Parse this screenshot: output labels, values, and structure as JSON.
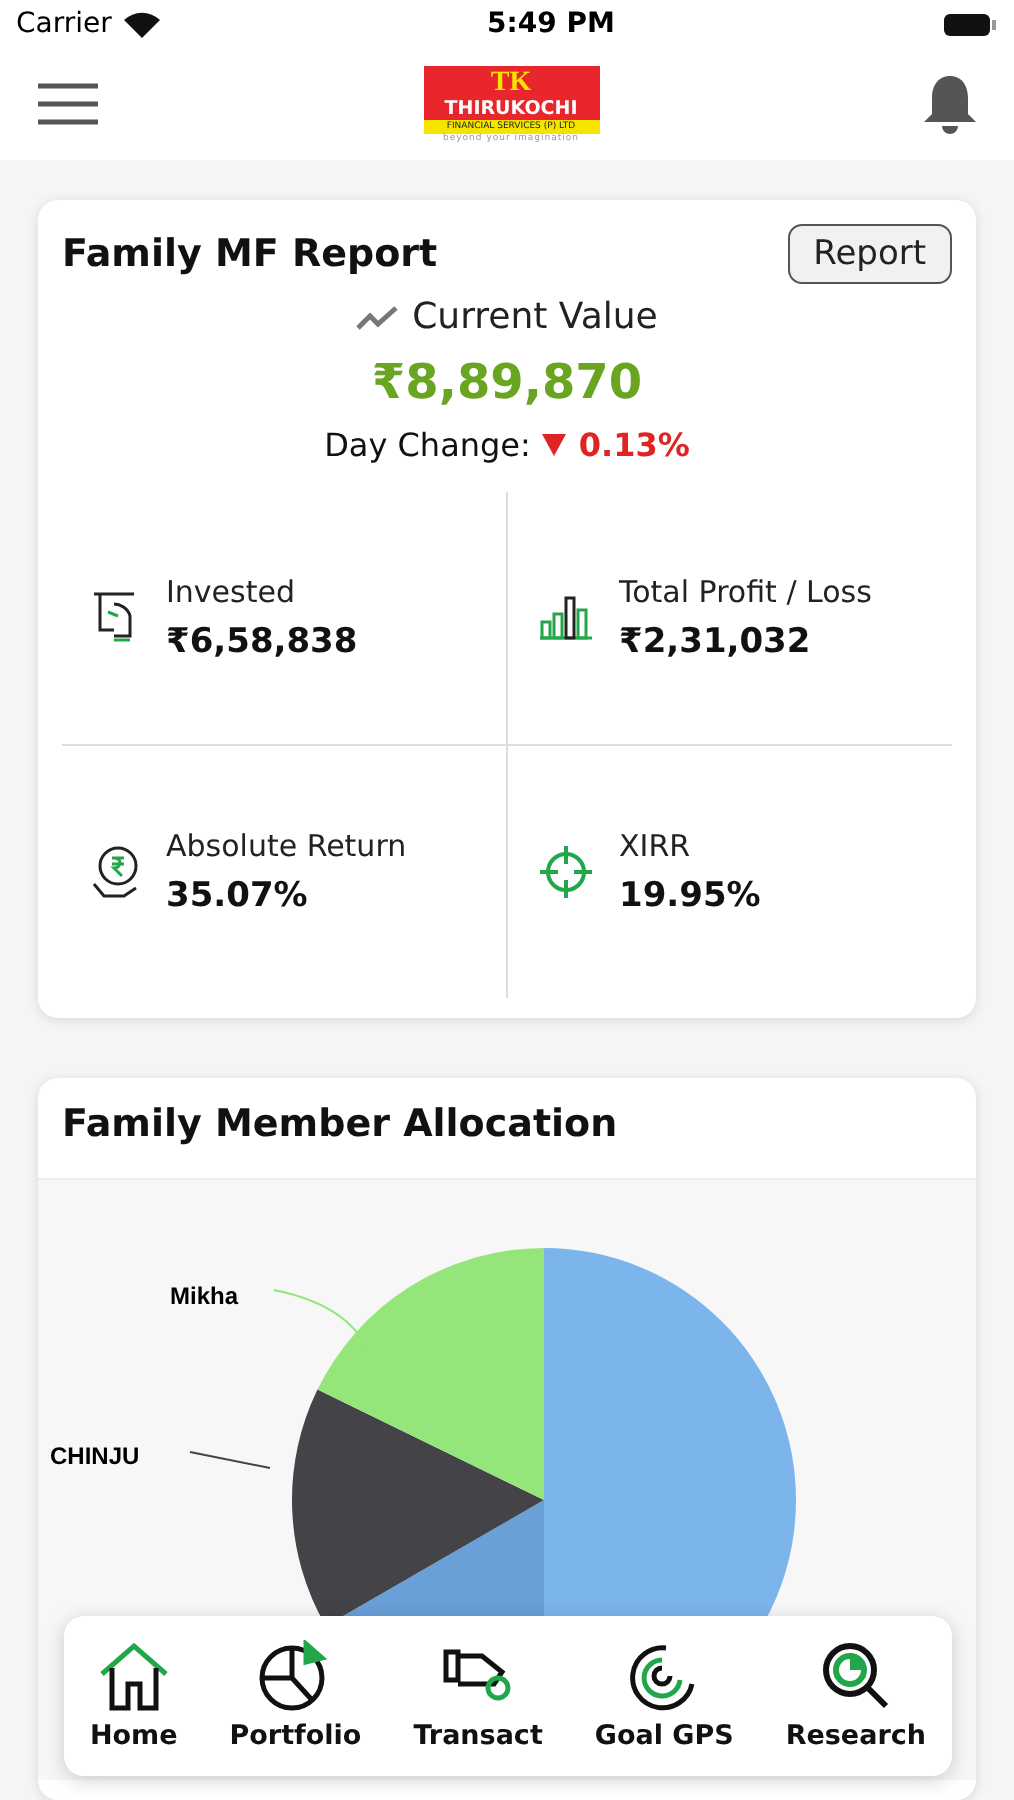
{
  "status_bar": {
    "carrier": "Carrier",
    "time": "5:49 PM"
  },
  "logo": {
    "monogram": "TK",
    "name": "THIRUKOCHI",
    "subtitle": "FINANCIAL SERVICES (P) LTD",
    "tagline": "beyond your imagination"
  },
  "report_card": {
    "title": "Family MF Report",
    "button": "Report",
    "current_value_label": "Current Value",
    "current_value": "₹8,89,870",
    "day_change_label": "Day Change:",
    "day_change": "0.13%",
    "day_change_negative": true,
    "stats": [
      {
        "kind": "invested",
        "label": "Invested",
        "value": "₹6,58,838"
      },
      {
        "kind": "profit",
        "label": "Total Profit / Loss",
        "value": "₹2,31,032"
      },
      {
        "kind": "return",
        "label": "Absolute Return",
        "value": "35.07%"
      },
      {
        "kind": "xirr",
        "label": "XIRR",
        "value": "19.95%"
      }
    ]
  },
  "allocation_card": {
    "title": "Family Member Allocation",
    "slices": [
      {
        "label": "Mikha",
        "color": "#94e67a"
      },
      {
        "label": "CHINJU",
        "color": "#434348"
      }
    ]
  },
  "bottom_nav": [
    {
      "kind": "home",
      "label": "Home"
    },
    {
      "kind": "portfolio",
      "label": "Portfolio"
    },
    {
      "kind": "transact",
      "label": "Transact"
    },
    {
      "kind": "goal",
      "label": "Goal GPS"
    },
    {
      "kind": "research",
      "label": "Research"
    }
  ]
}
